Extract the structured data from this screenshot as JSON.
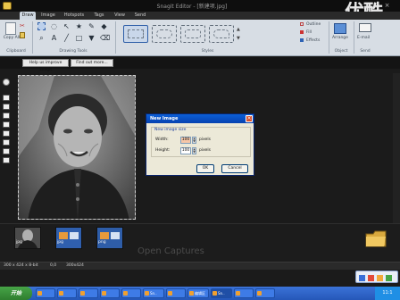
{
  "window": {
    "title": "Snagit Editor - [新建项.jpg]",
    "controls": [
      "_",
      "□",
      "×"
    ],
    "watermark": "优酷"
  },
  "menu_tabs": [
    {
      "label": "Draw",
      "active": true
    },
    {
      "label": "Image",
      "active": false
    },
    {
      "label": "Hotspots",
      "active": false
    },
    {
      "label": "Tags",
      "active": false
    },
    {
      "label": "View",
      "active": false
    },
    {
      "label": "Send",
      "active": false
    }
  ],
  "ribbon": {
    "clipboard": {
      "copy_label": "Copy All",
      "group_label": "Clipboard"
    },
    "drawing_tools": {
      "group_label": "Drawing Tools"
    },
    "styles": {
      "group_label": "Styles"
    },
    "outline_label": "Outline",
    "fill_label": "Fill",
    "effects_label": "Effects",
    "object": {
      "arrange_label": "Arrange",
      "group_label": "Object"
    },
    "send": {
      "email_label": "E-mail",
      "group_label": "Send"
    }
  },
  "notice_bar": {
    "improve_button": "Help us improve Snagit",
    "find_out_button": "Find out more..."
  },
  "dialog": {
    "title": "New Image",
    "group_label": "New image size",
    "width_label": "Width:",
    "width_value": "100",
    "width_unit": "pixels",
    "height_label": "Height:",
    "height_value": "100",
    "height_unit": "pixels",
    "ok_label": "OK",
    "cancel_label": "Cancel"
  },
  "tray": {
    "thumbnails": [
      {
        "caption": "jpg"
      },
      {
        "caption": "jpg"
      },
      {
        "caption": "png"
      }
    ],
    "open_captures_label": "Open Captures"
  },
  "status_bar": {
    "dimensions": "300 x 424 x 8-bit",
    "coords": "0,0",
    "size": "300x424"
  },
  "taskbar": {
    "start_label": "开始",
    "buttons": [
      "",
      "",
      "",
      "",
      "",
      "Sn..",
      "",
      "编辑区",
      "Sn..",
      "",
      ""
    ],
    "clock": "11:1"
  },
  "colors": {
    "ribbon_bg": "#d7dde4",
    "dialog_title": "#0a5fd8",
    "taskbar": "#2557b8",
    "start": "#46a447"
  }
}
